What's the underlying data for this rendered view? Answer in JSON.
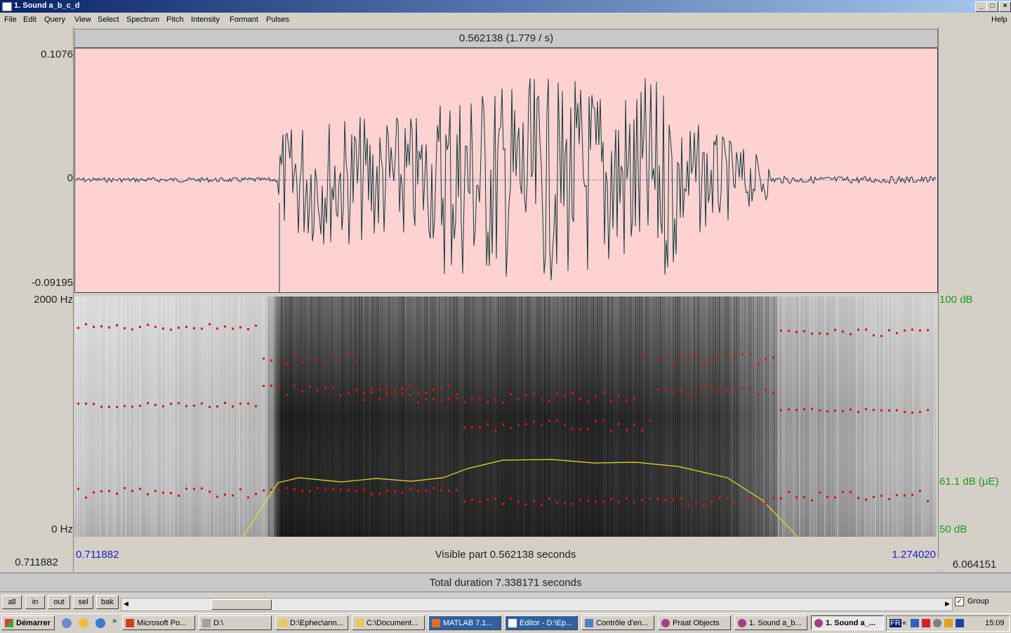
{
  "window": {
    "title": "1. Sound a_b_c_d",
    "buttons": [
      "_",
      "□",
      "×"
    ]
  },
  "menu": [
    "File",
    "Edit",
    "Query",
    "View",
    "Select",
    "Spectrum",
    "Pitch",
    "Intensity",
    "Formant",
    "Pulses"
  ],
  "help": "Help",
  "selection_text": "0.562138 (1.779 / s)",
  "waveform": {
    "ymax": "0.1076",
    "zero": "0",
    "ymin": "-0.09195"
  },
  "spectrogram": {
    "fmax": "2000 Hz",
    "fmin": "0 Hz"
  },
  "intensity": {
    "top": "100 dB",
    "mid": "61.1 dB (μE)",
    "bottom": "50 dB"
  },
  "left_time": "0.711882",
  "visible_start": "0.711882",
  "visible_text": "Visible part 0.562138 seconds",
  "visible_end": "1.274020",
  "right_time": "6.064151",
  "total_text": "Total duration 7.338171 seconds",
  "controls": {
    "all": "all",
    "in": "in",
    "out": "out",
    "sel": "sel",
    "bak": "bak",
    "group": "Group",
    "group_checked": true
  },
  "taskbar": {
    "start": "Démarrer",
    "items": [
      "Microsoft Po...",
      "D:\\",
      "D:\\Ephec\\ann...",
      "C:\\Document...",
      "MATLAB  7.1...",
      "Editor - D:\\Ep...",
      "Contrôle d'en...",
      "Praat Objects",
      "1. Sound a_b...",
      "1. Sound a_..."
    ],
    "active_index": 9,
    "lang": "FR",
    "clock": "15:09"
  },
  "colors": {
    "wave_bg": "#ffd2d2",
    "wave_line": "#0f3a3a",
    "formant": "#e01010",
    "intensity": "#e8e020",
    "intensity_label": "#1a9a1a",
    "time_label": "#2020c0"
  }
}
